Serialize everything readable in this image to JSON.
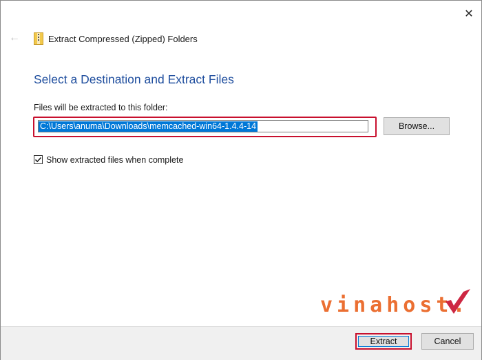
{
  "window": {
    "title": "Extract Compressed (Zipped) Folders",
    "close_glyph": "✕",
    "back_glyph": "←",
    "icons": {
      "back": "back-arrow-icon",
      "zip": "zip-folder-icon",
      "close": "close-icon"
    }
  },
  "main": {
    "heading": "Select a Destination and Extract Files",
    "dest_label": "Files will be extracted to this folder:",
    "dest_path": "C:\\Users\\anuma\\Downloads\\memcached-win64-1.4.4-14",
    "browse_label": "Browse...",
    "show_files_label": "Show extracted files when complete",
    "show_files_checked": true
  },
  "footer": {
    "extract_label": "Extract",
    "cancel_label": "Cancel"
  },
  "watermark": {
    "text": "vinahost."
  },
  "colors": {
    "heading": "#1f4e9e",
    "highlight": "#c8102e",
    "selection": "#0078d7",
    "watermark": "#e8560f"
  }
}
